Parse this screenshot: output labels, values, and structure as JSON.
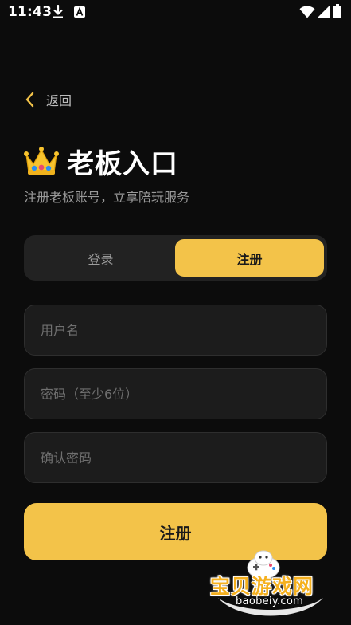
{
  "status_bar": {
    "time": "11:43",
    "icons": [
      "download-icon",
      "a-icon",
      "wifi-icon",
      "signal-icon",
      "battery-icon"
    ]
  },
  "header": {
    "back_label": "返回",
    "title": "老板入口",
    "subtitle": "注册老板账号，立享陪玩服务",
    "title_icon": "crown-icon"
  },
  "tabs": {
    "items": [
      {
        "label": "登录",
        "active": false
      },
      {
        "label": "注册",
        "active": true
      }
    ]
  },
  "form": {
    "username": {
      "value": "",
      "placeholder": "用户名"
    },
    "password": {
      "value": "",
      "placeholder": "密码（至少6位）"
    },
    "confirm_password": {
      "value": "",
      "placeholder": "确认密码"
    },
    "submit_label": "注册"
  },
  "watermark": {
    "brand": "宝贝游戏网",
    "domain": "baobeiy.com"
  },
  "colors": {
    "background": "#0c0c0c",
    "accent": "#f3c349",
    "input_bg": "#1c1c1c",
    "tab_bg": "#222222"
  }
}
